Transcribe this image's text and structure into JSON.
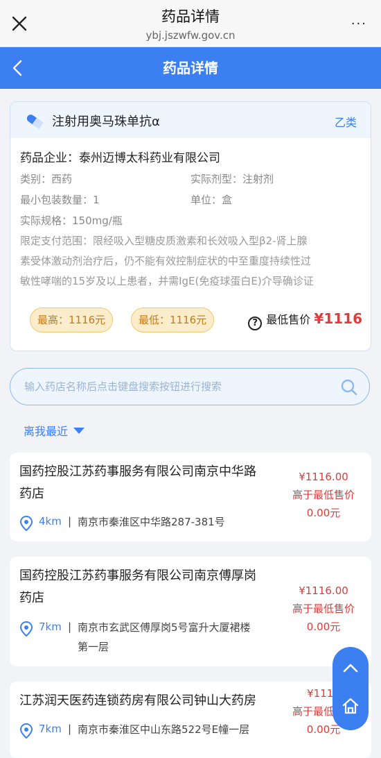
{
  "topbar": {
    "title": "药品详情",
    "url": "ybj.jszwfw.gov.cn",
    "more": "···"
  },
  "navbar": {
    "title": "药品详情"
  },
  "drug": {
    "name": "注射用奥马珠单抗α",
    "category": "乙类",
    "company": "药品企业：泰州迈博太科药业有限公司",
    "type": "类别：西药",
    "form": "实际剂型：注射剂",
    "min_pack": "最小包装数量：1",
    "unit": "单位：盒",
    "spec": "实际规格：150mg/瓶",
    "scope_lines": [
      "限定支付范围：限经吸入型糖皮质激素和长效吸入型β2-肾上腺",
      "素受体激动剂治疗后，仍不能有效控制症状的中至重度持续性过",
      "敏性哮喘的15岁及以上患者，并需IgE(免疫球蛋白E)介导确诊证"
    ],
    "max_price": "最高：1116元",
    "min_price": "最低：1116元",
    "lowest_label": "最低售价",
    "lowest_value": "¥1116"
  },
  "search": {
    "placeholder": "输入药店名称后点击键盘搜索按钮进行搜索"
  },
  "sort": {
    "label": "离我最近"
  },
  "pharmacies": [
    {
      "name_lines": [
        "国药控股江苏药事服务有限公司南京中华路",
        "药店"
      ],
      "distance": "4km",
      "address_lines": [
        "南京市秦淮区中华路287-381号"
      ],
      "price": "¥1116.00",
      "diff_label": "高于最低售价",
      "diff_value": "0.00元"
    },
    {
      "name_lines": [
        "国药控股江苏药事服务有限公司南京傅厚岗",
        "药店"
      ],
      "distance": "7km",
      "address_lines": [
        "南京市玄武区傅厚岗5号富升大厦裙楼",
        "第一层"
      ],
      "price": "¥1116.00",
      "diff_label": "高于最低售价",
      "diff_value": "0.00元"
    },
    {
      "name_lines": [
        "江苏润天医药连锁药房有限公司钟山大药房"
      ],
      "distance": "7km",
      "address_lines": [
        "南京市秦淮区中山东路522号E幢一层"
      ],
      "price": "¥1116",
      "diff_label": "高于最低售价",
      "diff_value": "0.00元"
    }
  ],
  "colors": {
    "primary": "#3b7ff0",
    "price_red": "#e03a3a",
    "tag_bg": "#fbeccc",
    "tag_text": "#c57a10"
  },
  "icons": [
    "close-icon",
    "more-icon",
    "back-icon",
    "pill-icon",
    "help-icon",
    "search-icon",
    "caret-down-icon",
    "location-icon",
    "arrow-up-icon",
    "home-icon"
  ]
}
